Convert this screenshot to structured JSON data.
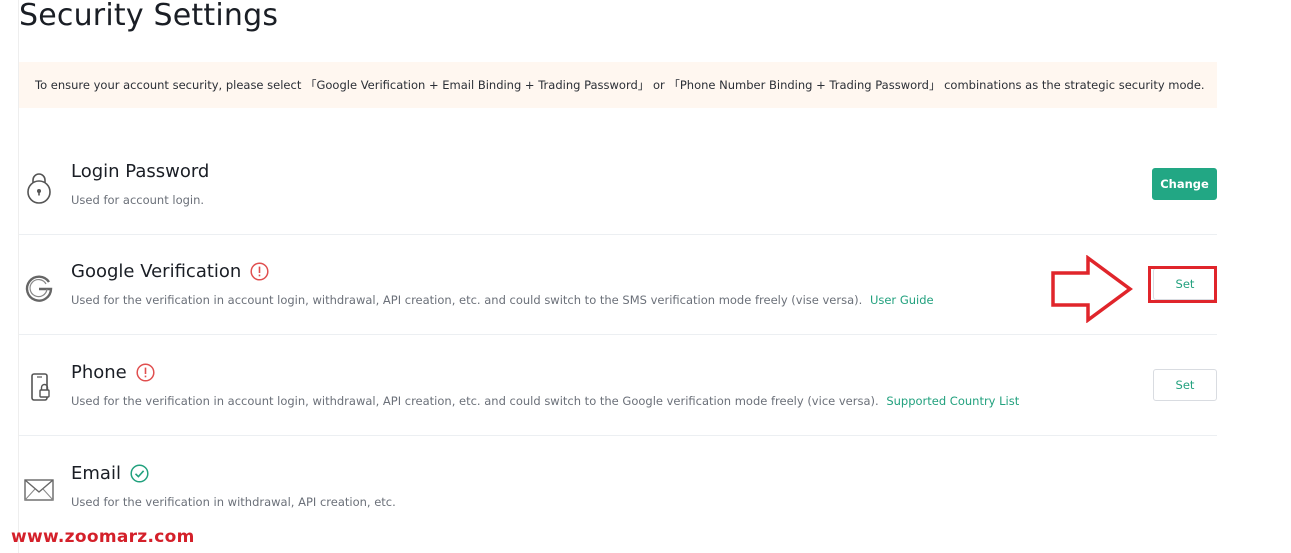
{
  "page": {
    "title": "Security Settings"
  },
  "notice": {
    "text": "To ensure your account security, please select 「Google Verification + Email Binding + Trading Password」 or 「Phone Number Binding + Trading Password」 combinations as the strategic security mode."
  },
  "items": [
    {
      "title": "Login Password",
      "icon": "lock-icon",
      "status": "",
      "description": "Used for account login.",
      "link": "",
      "button": "Change"
    },
    {
      "title": "Google Verification",
      "icon": "google-icon",
      "status": "warning",
      "description": "Used for the verification in account login, withdrawal, API creation, etc. and could switch to the SMS verification mode freely (vise versa).",
      "link": "User Guide",
      "button": "Set"
    },
    {
      "title": "Phone",
      "icon": "phone-lock-icon",
      "status": "warning",
      "description": "Used for the verification in account login, withdrawal, API creation, etc. and could switch to the Google verification mode freely (vice versa).",
      "link": "Supported Country List",
      "button": "Set"
    },
    {
      "title": "Email",
      "icon": "envelope-icon",
      "status": "verified",
      "description": "Used for the verification in withdrawal, API creation, etc.",
      "link": "",
      "button": ""
    }
  ],
  "colors": {
    "accent": "#22a784",
    "warning": "#e04f4f",
    "annotation": "#e0252b"
  },
  "annotation": {
    "icon": "arrow-right-outline-icon"
  },
  "watermark": {
    "text": "www.zoomarz.com"
  }
}
